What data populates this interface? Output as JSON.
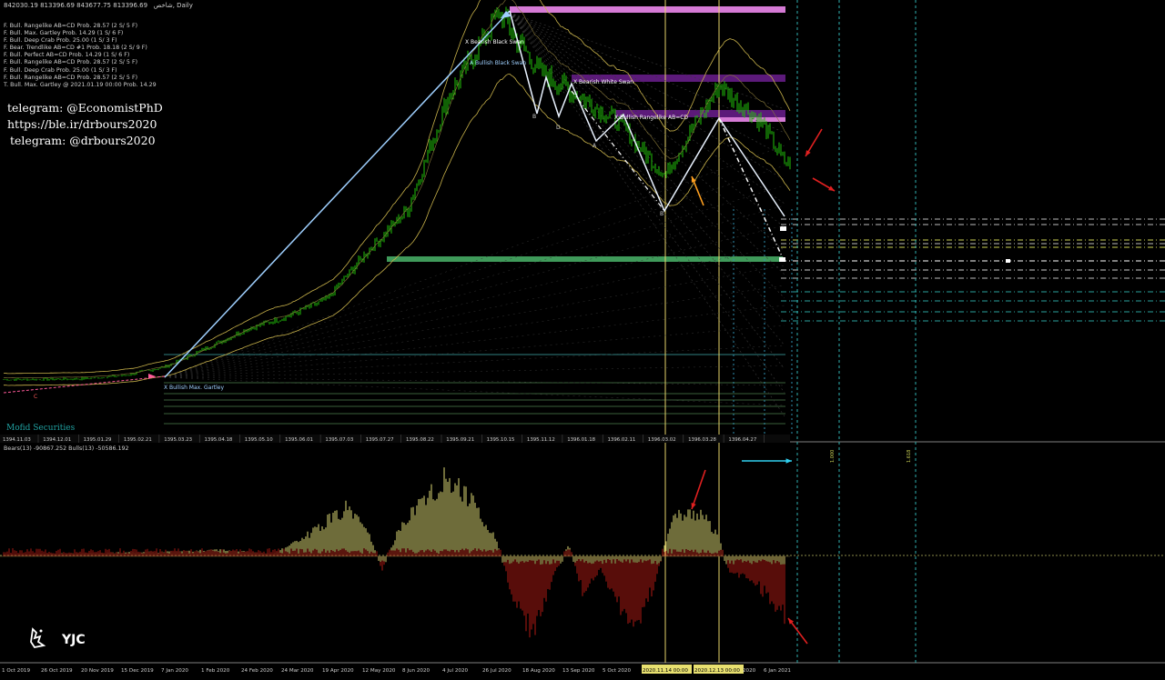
{
  "header": {
    "symbol": "شاخص",
    "timeframe": "Daily",
    "ohlc": "842030.19 813396.69 843677.75 813396.69"
  },
  "legend_lines": [
    "F. Bull. Rangelike AB=CD Prob. 28.57 (2 S/ 5 F)",
    "F. Bull. Max. Gartley Prob. 14.29 (1 S/ 6 F)",
    "F. Bull. Deep Crab Prob. 25.00 (1 S/ 3 F)",
    "F. Bear. Trendlike AB=CD #1 Prob. 18.18 (2 S/ 9 F)",
    "F. Bull. Perfect AB=CD Prob. 14.29 (1 S/ 6 F)",
    "F. Bull. Rangelike AB=CD Prob. 28.57 (2 S/ 5 F)",
    "F. Bull. Deep Crab Prob. 25.00 (1 S/ 3 F)",
    "F. Bull. Rangelike AB=CD Prob. 28.57 (2 S/ 5 F)",
    "T. Bull. Max. Gartley @ 2021.01.19 00:00 Prob. 14.29"
  ],
  "telegram": [
    "telegram: @EconomistPhD",
    "https://ble.ir/drbours2020",
    "telegram: @drbours2020"
  ],
  "watermark": "Mofid Securities",
  "indicator_header": "Bears(13) -90867.252 Bulls(13) -50586.192",
  "logo_text": "YJC",
  "colors": {
    "bg": "#000000",
    "candle": "#22c40a",
    "bollinger": "#c8b24a",
    "pattern": "#9fd0ff",
    "magenta": "#d57ad5",
    "purple": "#5c1a7a",
    "green_zone": "#3f9a5a",
    "cursor": "#e6d46a",
    "bull_bar": "#c8c46a",
    "bear_bar": "#a01812",
    "arrow_red": "#e02020",
    "arrow_orange": "#ffa020",
    "arrow_cyan": "#30d0f0"
  },
  "pattern_labels": {
    "bullish_black_swan_1": "X Bearish Black Swan",
    "bullish_black_swan_2": "A Bullish Black Swan",
    "bearish_white_swan": "X Bearish White Swan",
    "rangelike": "X Bullish Rangelike AB=CD",
    "gartley": "X Bullish Max. Gartley",
    "point_B1": "B",
    "point_D": "D",
    "point_B2": "B",
    "point_A": "A",
    "point_C": "C"
  },
  "fib_labels": [
    "1.000",
    "1.618"
  ],
  "chart_data": {
    "type": "line",
    "title": "",
    "xlabel": "",
    "ylabel": "",
    "x": [
      "2019-10-01",
      "2019-10-26",
      "2019-11-20",
      "2019-12-15",
      "2020-01-07",
      "2020-02-01",
      "2020-02-24",
      "2020-03-24",
      "2020-04-19",
      "2020-05-12",
      "2020-06-08",
      "2020-07-04",
      "2020-07-26",
      "2020-08-18",
      "2020-09-13",
      "2020-10-05",
      "2020-11-14",
      "2020-12-13",
      "2021-01-06",
      "2021-01-19"
    ],
    "series": [
      {
        "values": [
          186000,
          187000,
          190000,
          205000,
          245000,
          330000,
          420000,
          480000,
          560000,
          780000,
          980000,
          1500000,
          1900000,
          1630000,
          1510000,
          1380000,
          1140000,
          1560000,
          1380000,
          1200000
        ]
      }
    ],
    "x_tick_labels_bottom": [
      "1 Oct 2019",
      "26 Oct 2019",
      "20 Nov 2019",
      "15 Dec 2019",
      "7 Jan 2020",
      "1 Feb 2020",
      "24 Feb 2020",
      "24 Mar 2020",
      "19 Apr 2020",
      "12 May 2020",
      "8 Jun 2020",
      "4 Jul 2020",
      "26 Jul 2020",
      "18 Aug 2020",
      "13 Sep 2020",
      "5 Oct 2020",
      "2020.11.14 00:00",
      "2020.12.13 00:00",
      "2020",
      "6 Jan 2021"
    ],
    "x_tick_labels_shamsi": [
      "1394.11.03",
      "1394.12.01",
      "1395.01.29",
      "1395.02.21",
      "1395.03.23",
      "1395.04.18",
      "1395.05.10",
      "1395.06.01",
      "1395.07.03",
      "1395.07.27",
      "1395.08.22",
      "1395.09.21",
      "1395.10.15",
      "1395.11.12",
      "1396.01.18",
      "1396.02.11",
      "1396.03.02",
      "1396.03.28",
      "1396.04.27"
    ],
    "indicator": {
      "type": "bar",
      "name": "Bears/Bulls Power (13)",
      "bears": -90867.252,
      "bulls": -50586.192
    }
  }
}
